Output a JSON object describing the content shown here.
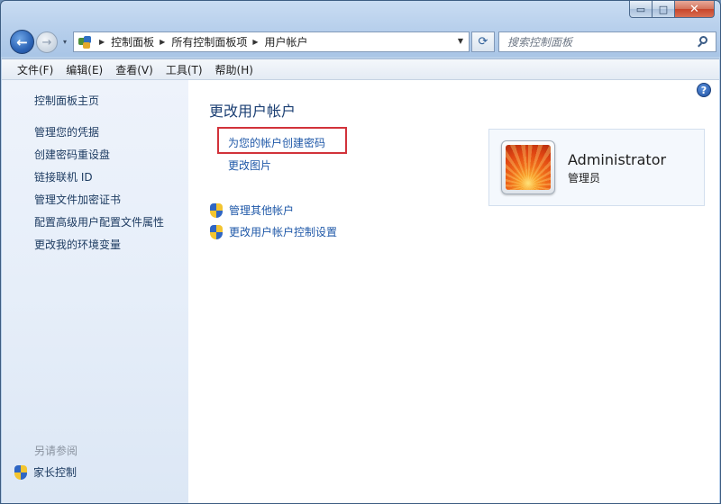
{
  "window": {
    "caption_min": "▭",
    "caption_max": "□",
    "caption_close": "✕"
  },
  "nav": {
    "back_glyph": "←",
    "forward_glyph": "→",
    "recent_glyph": "▾",
    "breadcrumbs": [
      "控制面板",
      "所有控制面板项",
      "用户帐户"
    ],
    "refresh_glyph": "⟳",
    "search_placeholder": "搜索控制面板"
  },
  "menu": [
    "文件(F)",
    "编辑(E)",
    "查看(V)",
    "工具(T)",
    "帮助(H)"
  ],
  "sidebar": {
    "home": "控制面板主页",
    "links": [
      "管理您的凭据",
      "创建密码重设盘",
      "链接联机 ID",
      "管理文件加密证书",
      "配置高级用户配置文件属性",
      "更改我的环境变量"
    ],
    "see_also_title": "另请参阅",
    "see_also_item": "家长控制"
  },
  "main": {
    "title": "更改用户帐户",
    "tasks": [
      "为您的帐户创建密码",
      "更改图片"
    ],
    "admin_tasks": [
      "管理其他帐户",
      "更改用户帐户控制设置"
    ],
    "help_glyph": "?"
  },
  "user": {
    "name": "Administrator",
    "role": "管理员"
  },
  "colors": {
    "link": "#1f58a8",
    "title": "#1b3f73",
    "highlight": "#d2323a"
  }
}
